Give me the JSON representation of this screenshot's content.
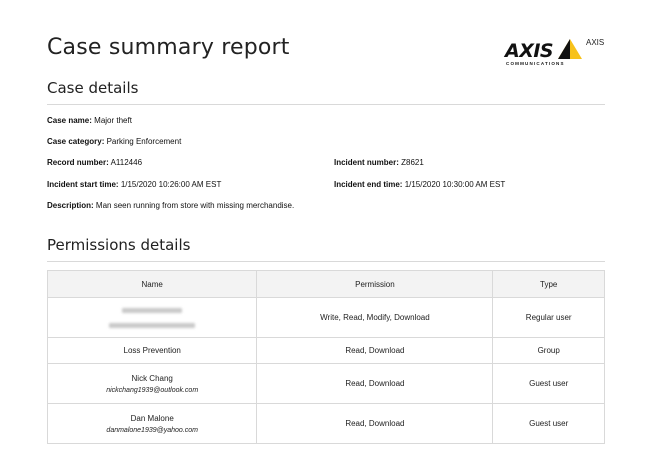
{
  "report_title": "Case summary report",
  "logo": {
    "wordmark": "AXIS",
    "subtitle": "COMMUNICATIONS",
    "side_text": "AXIS"
  },
  "case_details": {
    "heading": "Case details",
    "case_name": {
      "label": "Case name:",
      "value": "Major theft"
    },
    "case_category": {
      "label": "Case category:",
      "value": "Parking Enforcement"
    },
    "record_number": {
      "label": "Record number:",
      "value": "A112446"
    },
    "incident_number": {
      "label": "Incident number:",
      "value": "Z8621"
    },
    "incident_start": {
      "label": "Incident start time:",
      "value": "1/15/2020 10:26:00 AM EST"
    },
    "incident_end": {
      "label": "Incident end time:",
      "value": "1/15/2020 10:30:00 AM EST"
    },
    "description": {
      "label": "Description:",
      "value": "Man seen running from store with missing merchandise."
    }
  },
  "permissions": {
    "heading": "Permissions details",
    "columns": {
      "name": "Name",
      "permission": "Permission",
      "type": "Type"
    },
    "rows": [
      {
        "name": "",
        "email": "",
        "permission": "Write, Read, Modify, Download",
        "type": "Regular user"
      },
      {
        "name": "Loss Prevention",
        "email": "",
        "permission": "Read, Download",
        "type": "Group"
      },
      {
        "name": "Nick Chang",
        "email": "nickchang1939@outlook.com",
        "permission": "Read, Download",
        "type": "Guest user"
      },
      {
        "name": "Dan Malone",
        "email": "danmalone1939@yahoo.com",
        "permission": "Read, Download",
        "type": "Guest user"
      }
    ]
  }
}
